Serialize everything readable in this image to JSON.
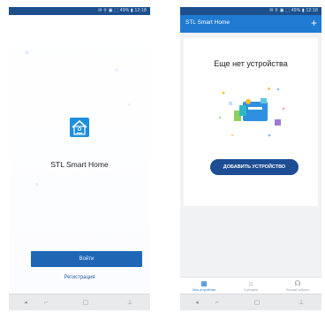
{
  "left_screen": {
    "status_text": "✉ ⚲ ▣ ⬚ 49% ▮ 12:18",
    "app_name": "STL Smart Home",
    "login_label": "Войти",
    "register_label": "Регистрация",
    "nav": {
      "back": "◂",
      "home": "▢",
      "recent": "⌐"
    }
  },
  "right_screen": {
    "status_text": "✉ ⚲ ▣ ⬚ 49% ▮ 12:18",
    "header_title": "STL Smart Home",
    "add_icon": "+",
    "empty_title": "Еще нет устройства",
    "add_device_label": "ДОБАВИТЬ УСТРОЙСТВО",
    "tabs": [
      {
        "label": "Мои устройства",
        "icon": "▦"
      },
      {
        "label": "Сценарии",
        "icon": "⌂"
      },
      {
        "label": "Личный кабинет",
        "icon": "☊"
      }
    ],
    "nav": {
      "back": "◂",
      "home": "▢",
      "recent": "⌐"
    }
  },
  "colors": {
    "status_bar": "#1c4f8c",
    "primary": "#1f7ad1",
    "button": "#1f67b5",
    "button_dark": "#1d4d93",
    "link": "#245ea6"
  }
}
